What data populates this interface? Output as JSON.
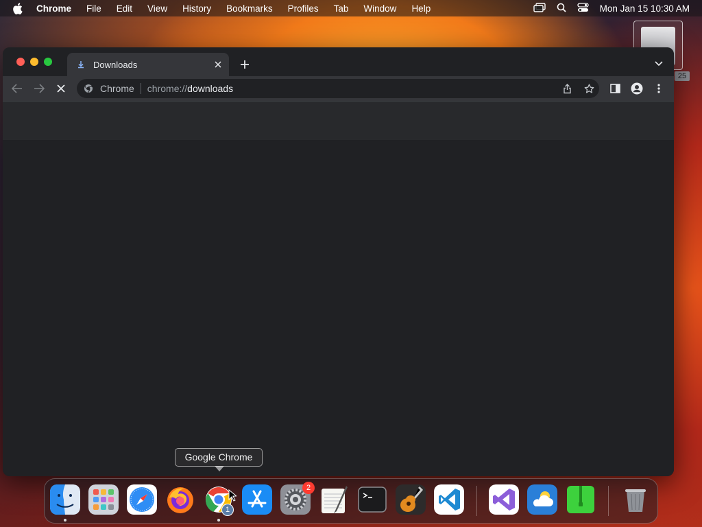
{
  "menubar": {
    "apple_icon": "apple-logo-icon",
    "app_name": "Chrome",
    "items": [
      "File",
      "Edit",
      "View",
      "History",
      "Bookmarks",
      "Profiles",
      "Tab",
      "Window",
      "Help"
    ],
    "status_icons": [
      "screen-mirroring-icon",
      "spotlight-search-icon",
      "control-center-icon"
    ],
    "clock": "Mon Jan 15  10:30 AM"
  },
  "desktop": {
    "drive_label": "25"
  },
  "window": {
    "tab": {
      "title": "Downloads",
      "favicon": "download-icon"
    },
    "toolbar": {
      "site_chip": "Chrome",
      "url_prefix": "chrome://",
      "url_host": "downloads"
    }
  },
  "dock": {
    "tooltip": "Google Chrome",
    "apps": [
      {
        "name": "Finder",
        "running": true
      },
      {
        "name": "Launchpad",
        "running": false
      },
      {
        "name": "Safari",
        "running": false
      },
      {
        "name": "Firefox",
        "running": false
      },
      {
        "name": "Google Chrome",
        "running": true,
        "badge": "1"
      },
      {
        "name": "App Store",
        "running": false
      },
      {
        "name": "System Settings",
        "running": false,
        "badge": "2"
      },
      {
        "name": "TextEdit",
        "running": false
      },
      {
        "name": "Terminal",
        "running": false
      },
      {
        "name": "GarageBand",
        "running": false
      },
      {
        "name": "Visual Studio Code",
        "running": false
      },
      {
        "name": "Visual Studio",
        "running": false
      },
      {
        "name": "Weather",
        "running": false
      },
      {
        "name": "Archive Utility",
        "running": false
      },
      {
        "name": "Trash",
        "running": false
      }
    ]
  },
  "colors": {
    "window_bg": "#202124",
    "toolbar_bg": "#35363a",
    "close": "#ff5f57",
    "minimize": "#febc2e",
    "maximize": "#28c840",
    "badge": "#ff3b30"
  }
}
